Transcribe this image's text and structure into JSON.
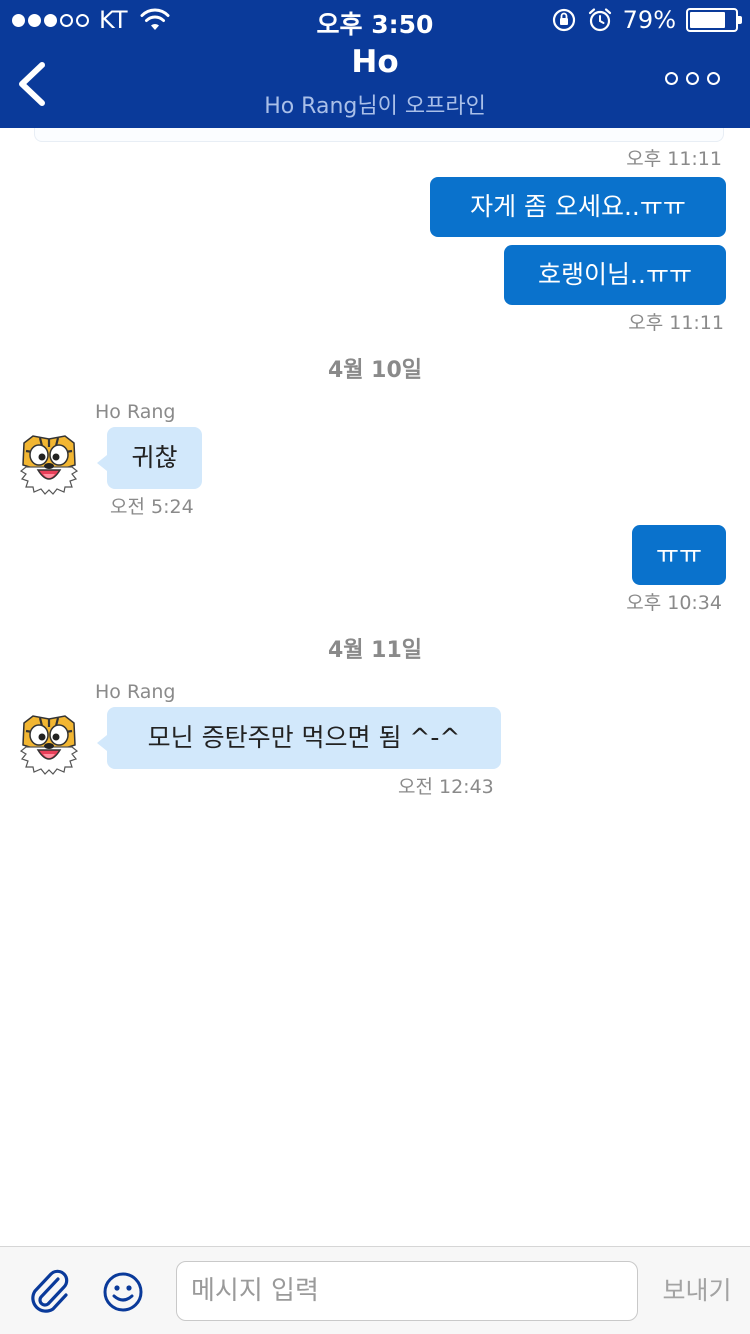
{
  "status_bar": {
    "carrier": "KT",
    "time": "오후 3:50",
    "battery_percent": "79%",
    "battery_level": 0.79,
    "signal_bars_filled": 3,
    "signal_bars_total": 5
  },
  "header": {
    "title": "Ho",
    "subtitle": "Ho Rang님이 오프라인",
    "back_icon": "chevron-left-icon",
    "more_icon": "more-horizontal-icon",
    "background_color": "#0a3a9a"
  },
  "colors": {
    "outgoing_bubble": "#0a72cc",
    "incoming_bubble": "#d2e8fb",
    "meta_text": "#8a8a8a"
  },
  "messages": {
    "ts_top": "오후 11:11",
    "out_1": "자게 좀 오세요..ㅠㅠ",
    "out_2": "호랭이님..ㅠㅠ",
    "ts_out_2": "오후 11:11",
    "date_1": "4월 10일",
    "sender_1": "Ho Rang",
    "in_1": "귀찮",
    "ts_in_1": "오전 5:24",
    "out_3": "ㅠㅠ",
    "ts_out_3": "오후 10:34",
    "date_2": "4월 11일",
    "sender_2": "Ho Rang",
    "in_2": "모닌 증탄주만 먹으면 됨 ^-^",
    "ts_in_2": "오전 12:43"
  },
  "input_bar": {
    "attach_icon": "paperclip-icon",
    "emoji_icon": "smiley-icon",
    "placeholder": "메시지 입력",
    "value": "",
    "send_label": "보내기"
  }
}
